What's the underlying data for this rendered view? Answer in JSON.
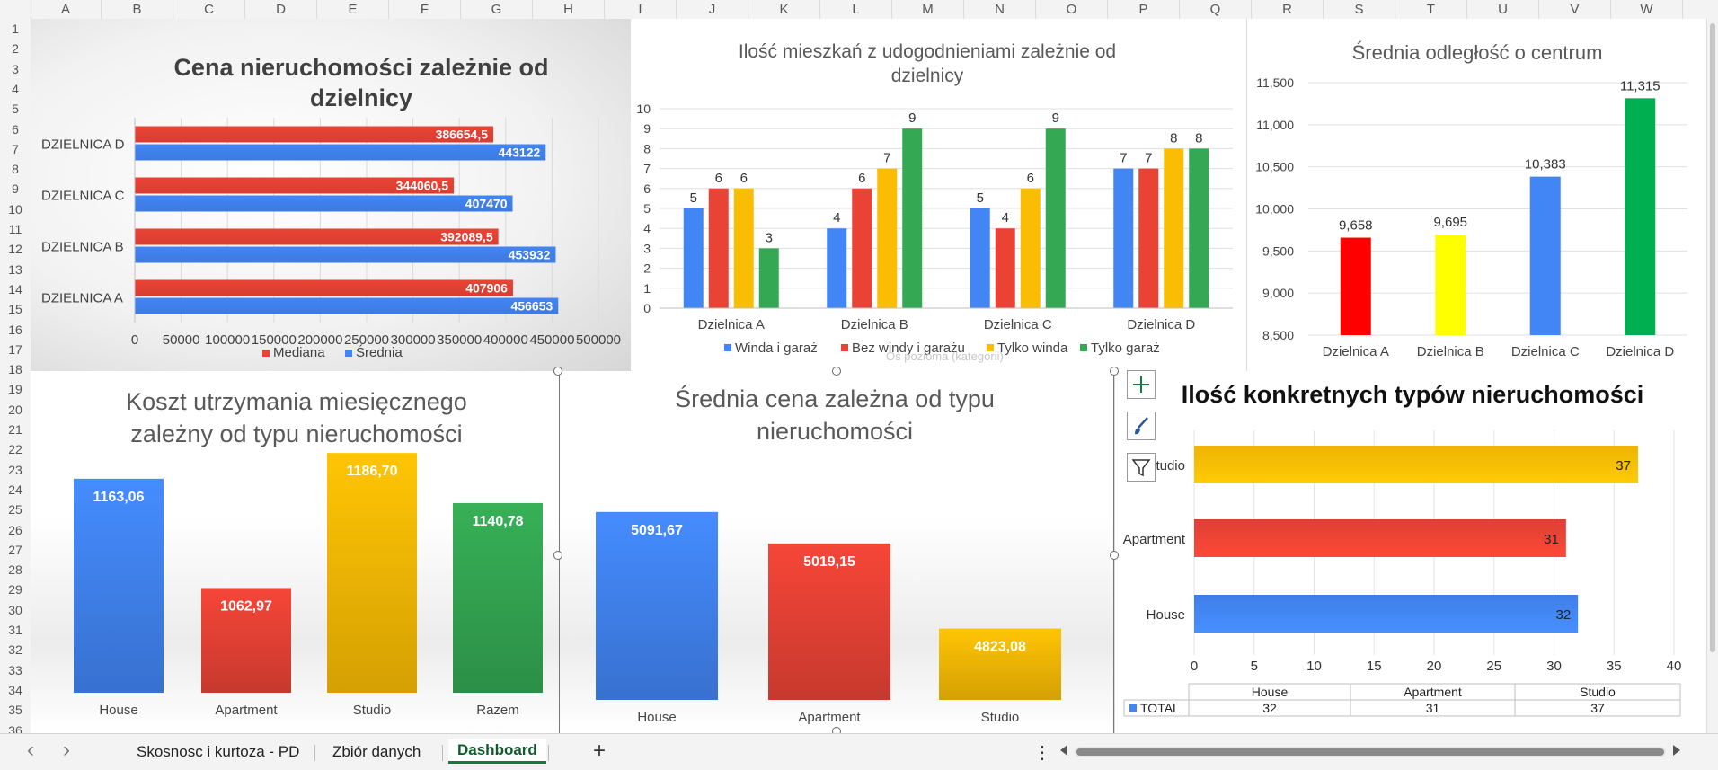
{
  "columns": [
    "A",
    "B",
    "C",
    "D",
    "E",
    "F",
    "G",
    "H",
    "I",
    "J",
    "K",
    "L",
    "M",
    "N",
    "O",
    "P",
    "Q",
    "R",
    "S",
    "T",
    "U",
    "V",
    "W"
  ],
  "rows": [
    "1",
    "2",
    "3",
    "4",
    "5",
    "6",
    "7",
    "8",
    "9",
    "10",
    "11",
    "12",
    "13",
    "14",
    "15",
    "16",
    "17",
    "18",
    "19",
    "20",
    "21",
    "22",
    "23",
    "24",
    "25",
    "26",
    "27",
    "28",
    "29",
    "30",
    "31",
    "32",
    "33",
    "34",
    "35",
    "36"
  ],
  "sheet_tabs": [
    "Skosnosc i kurtoza - PD",
    "Zbiór danych",
    "Dashboard"
  ],
  "active_tab": "Dashboard",
  "add_sheet": "+",
  "more_menu": "⋮",
  "nav_prev": "‹",
  "nav_next": "›",
  "icons": {
    "add_element": "plus-icon",
    "chart_styles": "brush-icon",
    "chart_filters": "funnel-icon"
  },
  "tooltip_fragment": "Oś pozioma (kategorii)",
  "colors": {
    "blue": "#4285f4",
    "red": "#ea4335",
    "yellow": "#fbbc04",
    "green": "#34a853",
    "pure_red": "#ff0000",
    "pure_yellow": "#ffff00",
    "pure_green": "#00b050"
  },
  "chart_data": [
    {
      "type": "bar",
      "orientation": "horizontal",
      "title": "Cena nieruchomości zależnie od dzielnicy",
      "categories": [
        "DZIELNICA A",
        "DZIELNICA B",
        "DZIELNICA C",
        "DZIELNICA D"
      ],
      "series": [
        {
          "name": "Mediana",
          "values": [
            407906,
            392089.5,
            344060.5,
            386654.5
          ],
          "labels": [
            "407906",
            "392089,5",
            "344060,5",
            "386654,5"
          ],
          "color": "#ea4335"
        },
        {
          "name": "Średnia",
          "values": [
            456653,
            453932,
            407470,
            443122
          ],
          "labels": [
            "456653",
            "453932",
            "407470",
            "443122"
          ],
          "color": "#4285f4"
        }
      ],
      "x_ticks": [
        "0",
        "50000",
        "100000",
        "150000",
        "200000",
        "250000",
        "300000",
        "350000",
        "400000",
        "450000",
        "500000"
      ],
      "xlim": [
        0,
        500000
      ],
      "legend": "bottom",
      "grid": true
    },
    {
      "type": "bar",
      "title": "Ilość mieszkań z udogodnieniami zależnie od dzielnicy",
      "categories": [
        "Dzielnica A",
        "Dzielnica B",
        "Dzielnica C",
        "Dzielnica D"
      ],
      "series": [
        {
          "name": "Winda i garaż",
          "values": [
            5,
            4,
            5,
            7
          ],
          "color": "#4285f4"
        },
        {
          "name": "Bez windy i garażu",
          "values": [
            6,
            6,
            4,
            7
          ],
          "color": "#ea4335"
        },
        {
          "name": "Tylko winda",
          "values": [
            6,
            7,
            6,
            8
          ],
          "color": "#fbbc04"
        },
        {
          "name": "Tylko garaż",
          "values": [
            3,
            9,
            9,
            8
          ],
          "color": "#34a853"
        }
      ],
      "y_ticks": [
        "0",
        "1",
        "2",
        "3",
        "4",
        "5",
        "6",
        "7",
        "8",
        "9",
        "10"
      ],
      "ylim": [
        0,
        10
      ],
      "legend": "bottom",
      "grid": true
    },
    {
      "type": "bar",
      "title": "Średnia odległość o centrum",
      "categories": [
        "Dzielnica A",
        "Dzielnica B",
        "Dzielnica C",
        "Dzielnica D"
      ],
      "values": [
        9658,
        9695,
        10383,
        11315
      ],
      "labels": [
        "9,658",
        "9,695",
        "10,383",
        "11,315"
      ],
      "colors": [
        "#ff0000",
        "#ffff00",
        "#4285f4",
        "#00b050"
      ],
      "y_ticks": [
        "8,500",
        "9,000",
        "9,500",
        "10,000",
        "10,500",
        "11,000",
        "11,500"
      ],
      "ylim": [
        8500,
        11500
      ],
      "grid": true
    },
    {
      "type": "bar",
      "title": "Koszt utrzymania miesięcznego zależny od typu nieruchomości",
      "categories": [
        "House",
        "Apartment",
        "Studio",
        "Razem"
      ],
      "values": [
        1163.06,
        1062.97,
        1186.7,
        1140.78
      ],
      "labels": [
        "1163,06",
        "1062,97",
        "1186,70",
        "1140,78"
      ],
      "colors": [
        "#4285f4",
        "#ea4335",
        "#fbbc04",
        "#34a853"
      ],
      "ylim": [
        1000,
        1200
      ],
      "grid": false
    },
    {
      "type": "bar",
      "title": "Średnia cena zależna od typu nieruchomości",
      "categories": [
        "House",
        "Apartment",
        "Studio"
      ],
      "values": [
        5091.67,
        5019.15,
        4823.08
      ],
      "labels": [
        "5091,67",
        "5019,15",
        "4823,08"
      ],
      "colors": [
        "#4285f4",
        "#ea4335",
        "#fbbc04"
      ],
      "ylim": [
        4700,
        5100
      ],
      "grid": false
    },
    {
      "type": "bar",
      "orientation": "horizontal",
      "title": "Ilość konkretnych typów nieruchomości",
      "categories": [
        "House",
        "Apartment",
        "Studio"
      ],
      "values": [
        32,
        31,
        37
      ],
      "labels": [
        "32",
        "31",
        "37"
      ],
      "colors": [
        "#4285f4",
        "#ea4335",
        "#fbbc04"
      ],
      "x_ticks": [
        "0",
        "5",
        "10",
        "15",
        "20",
        "25",
        "30",
        "35",
        "40"
      ],
      "xlim": [
        0,
        40
      ],
      "grid": true,
      "data_table": {
        "series_name": "TOTAL",
        "headers": [
          "House",
          "Apartment",
          "Studio"
        ],
        "values": [
          "32",
          "31",
          "37"
        ]
      }
    }
  ]
}
